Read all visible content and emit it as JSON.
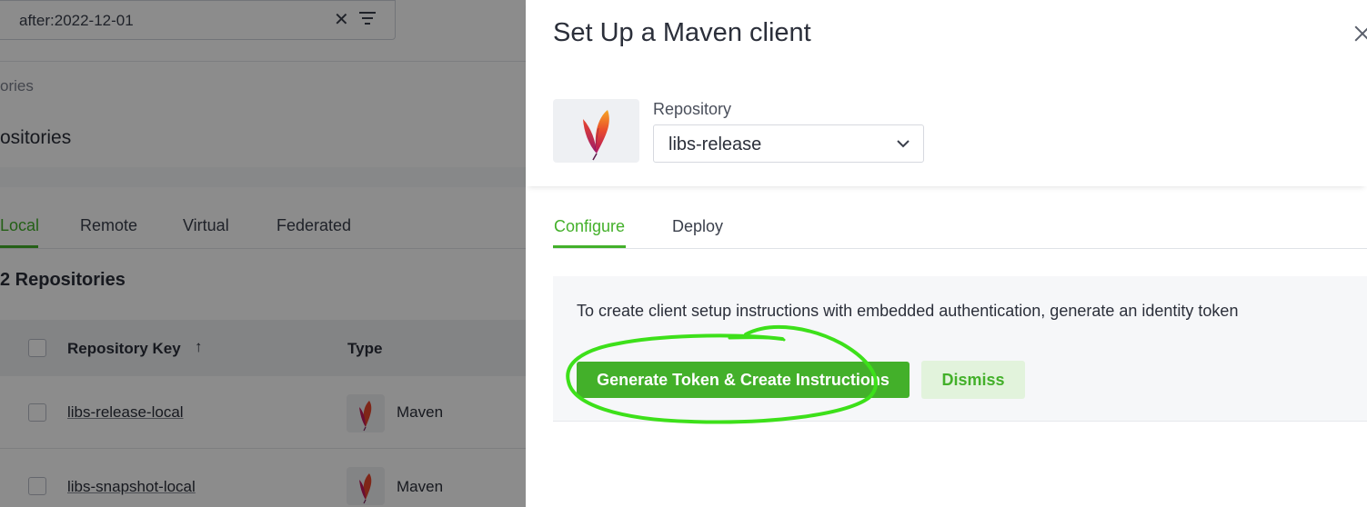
{
  "background": {
    "search": {
      "value": "after:2022-12-01"
    },
    "breadcrumb": "ories",
    "page_title": "ositories",
    "tabs": [
      {
        "label": "Local",
        "active": true
      },
      {
        "label": "Remote",
        "active": false
      },
      {
        "label": "Virtual",
        "active": false
      },
      {
        "label": "Federated",
        "active": false
      }
    ],
    "repo_count": "2 Repositories",
    "table": {
      "columns": {
        "key": "Repository Key",
        "type": "Type"
      },
      "rows": [
        {
          "key": "libs-release-local",
          "type": "Maven",
          "icon": "maven-feather-icon"
        },
        {
          "key": "libs-snapshot-local",
          "type": "Maven",
          "icon": "maven-feather-icon"
        }
      ]
    }
  },
  "drawer": {
    "title": "Set Up a Maven client",
    "repository_label": "Repository",
    "repository_value": "libs-release",
    "tabs": [
      {
        "label": "Configure",
        "active": true
      },
      {
        "label": "Deploy",
        "active": false
      }
    ],
    "token_message": "To create client setup instructions with embedded authentication, generate an identity token",
    "generate_button": "Generate Token & Create Instructions",
    "dismiss_button": "Dismiss"
  },
  "colors": {
    "accent": "#43b02a",
    "dismiss_bg": "#e2f3dc",
    "annotation": "#3de01a",
    "overlay": "rgba(0,0,0,0.45)"
  }
}
